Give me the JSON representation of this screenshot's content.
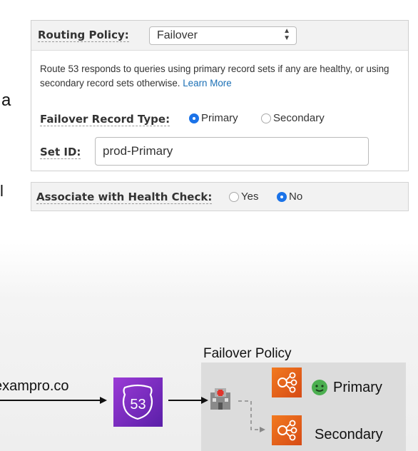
{
  "left_fragments": {
    "a": "a",
    "bracket": "l"
  },
  "routing": {
    "label": "Routing Policy:",
    "selected": "Failover",
    "description": "Route 53 responds to queries using primary record sets if any are healthy, or using secondary record sets otherwise.",
    "learn_more": "Learn More"
  },
  "failover": {
    "label": "Failover Record Type:",
    "options": [
      {
        "label": "Primary",
        "selected": true
      },
      {
        "label": "Secondary",
        "selected": false
      }
    ]
  },
  "set_id": {
    "label": "Set ID:",
    "value": "prod-Primary"
  },
  "health_check": {
    "label": "Associate with Health Check:",
    "options": [
      {
        "label": "Yes",
        "selected": false
      },
      {
        "label": "No",
        "selected": true
      }
    ]
  },
  "diagram": {
    "title": "Failover Policy",
    "domain": "exampro.co",
    "route53_text": "53",
    "primary": "Primary",
    "secondary": "Secondary",
    "colors": {
      "accent_radio": "#1b73e8",
      "route53": "#7b2fc7",
      "elb": "#e8601c"
    }
  }
}
